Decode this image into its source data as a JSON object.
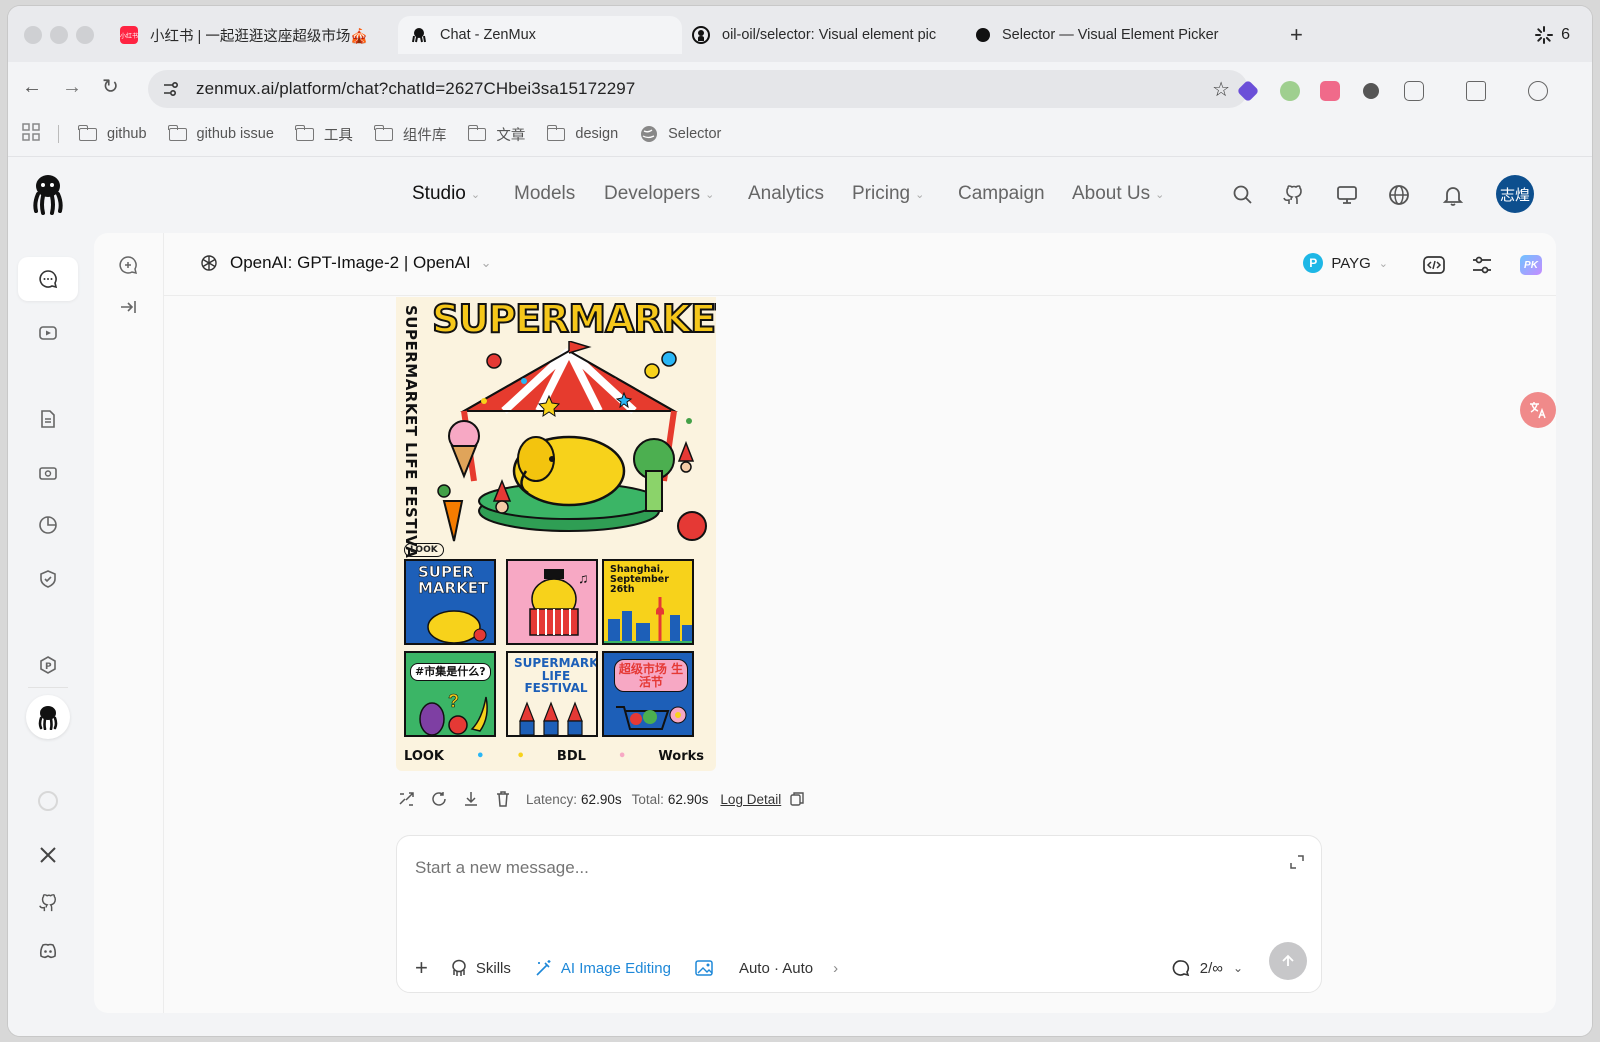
{
  "browser": {
    "tabs": [
      {
        "title": "小红书 | 一起逛逛这座超级市场🎪",
        "favicon_text": "小红书",
        "favicon_color": "#ff2442"
      },
      {
        "title": "Chat - ZenMux",
        "active": true
      },
      {
        "title": "oil-oil/selector: Visual element pic"
      },
      {
        "title": "Selector — Visual Element Picker"
      }
    ],
    "tab_counter": "6",
    "url": "zenmux.ai/platform/chat?chatId=2627CHbei3sa15172297",
    "bookmarks": [
      "github",
      "github issue",
      "工具",
      "组件库",
      "文章",
      "design",
      "Selector"
    ]
  },
  "nav": {
    "items": [
      {
        "label": "Studio",
        "caret": true,
        "active": true
      },
      {
        "label": "Models",
        "caret": false
      },
      {
        "label": "Developers",
        "caret": true
      },
      {
        "label": "Analytics",
        "caret": false
      },
      {
        "label": "Pricing",
        "caret": true
      },
      {
        "label": "Campaign",
        "caret": false
      },
      {
        "label": "About Us",
        "caret": true
      }
    ],
    "avatar_text": "志煌"
  },
  "chat": {
    "model_label": "OpenAI: GPT-Image-2 | OpenAI",
    "plan_label": "PAYG",
    "pk_label": "PK",
    "poster": {
      "title": "SUPERMARKET",
      "vertical_text": "SUPERMARKET LIFE FESTIVAL",
      "look_badge": "LOOK",
      "cell1": "SUPER MARKET",
      "cell3": "Shanghai, September 26th",
      "cell4": "#市集是什么?",
      "cell5": "SUPERMARKET LIFE FESTIVAL",
      "cell6": "超级市场 生活节",
      "footer": [
        "LOOK",
        "BDL",
        "Works"
      ]
    },
    "meta": {
      "latency_label": "Latency:",
      "latency_value": "62.90s",
      "total_label": "Total:",
      "total_value": "62.90s",
      "log_detail": "Log Detail"
    },
    "composer": {
      "placeholder": "Start a new message...",
      "skills_label": "Skills",
      "image_edit_label": "AI Image Editing",
      "auto_label": "Auto · Auto",
      "context_label": "2/∞"
    }
  },
  "colors": {
    "accent_blue": "#1e88d8",
    "avatar_bg": "#0d4f8e",
    "poster_yellow": "#f5c71a"
  }
}
